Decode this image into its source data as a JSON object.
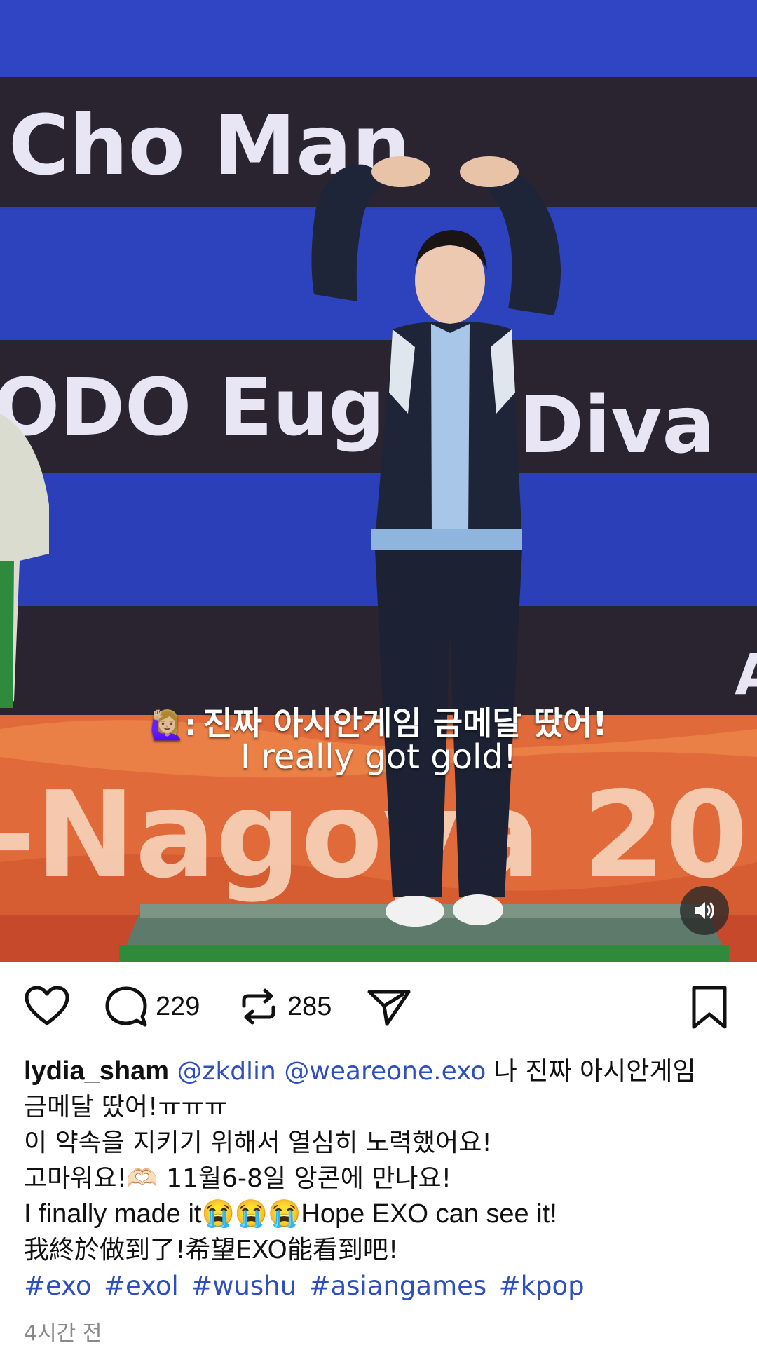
{
  "media": {
    "board": {
      "name_top": "Cho Man",
      "name_mid_left": "ODO Euger",
      "name_mid_right": "Diva",
      "edge_letter": "A"
    },
    "banner_text": "-Nagoya 20",
    "subtitle_ko": "진짜 아시안게임 금메달 땄어!",
    "subtitle_speaker": "🙋🏼‍♀️:",
    "subtitle_en": "I really got gold!",
    "mute_icon": "speaker-icon"
  },
  "actions": {
    "comments_count": "229",
    "reposts_count": "285"
  },
  "post": {
    "username": "lydia_sham",
    "mention_1": "@zkdlin",
    "mention_2": "@weareone.exo",
    "line1_text": "나 진짜 아시안게임",
    "line2": "금메달 땄어!ㅠㅠㅠ",
    "line3": "이 약속을 지키기 위해서 열심히 노력했어요!",
    "line4": "고마워요!🫶🏻 11월6-8일 앙콘에 만나요!",
    "line5": "I finally made it😭😭😭Hope EXO can see it!",
    "line6": "我終於做到了!希望EXO能看到吧!",
    "hashtags": [
      "#exo",
      "#exol",
      "#wushu",
      "#asiangames",
      "#kpop"
    ],
    "timestamp": "4시간 전"
  },
  "colors": {
    "link": "#2e4fbf",
    "board_blue": "#2b3fb8",
    "board_dark": "#2a2330",
    "banner_orange": "#e06a3a"
  }
}
